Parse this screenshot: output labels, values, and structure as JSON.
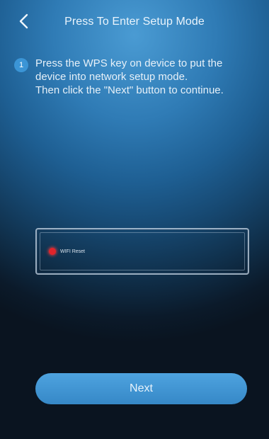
{
  "header": {
    "title": "Press To Enter Setup Mode",
    "back_icon": "chevron-left-icon"
  },
  "step": {
    "number": "1",
    "lines": [
      "Press the WPS key on device to put the",
      "device into network setup mode.",
      "Then click the \"Next\" button to continue."
    ]
  },
  "device": {
    "label": "WIFI Reset",
    "led_color": "#e0242b"
  },
  "next_button": {
    "label": "Next"
  },
  "colors": {
    "accent": "#3b95d6"
  }
}
